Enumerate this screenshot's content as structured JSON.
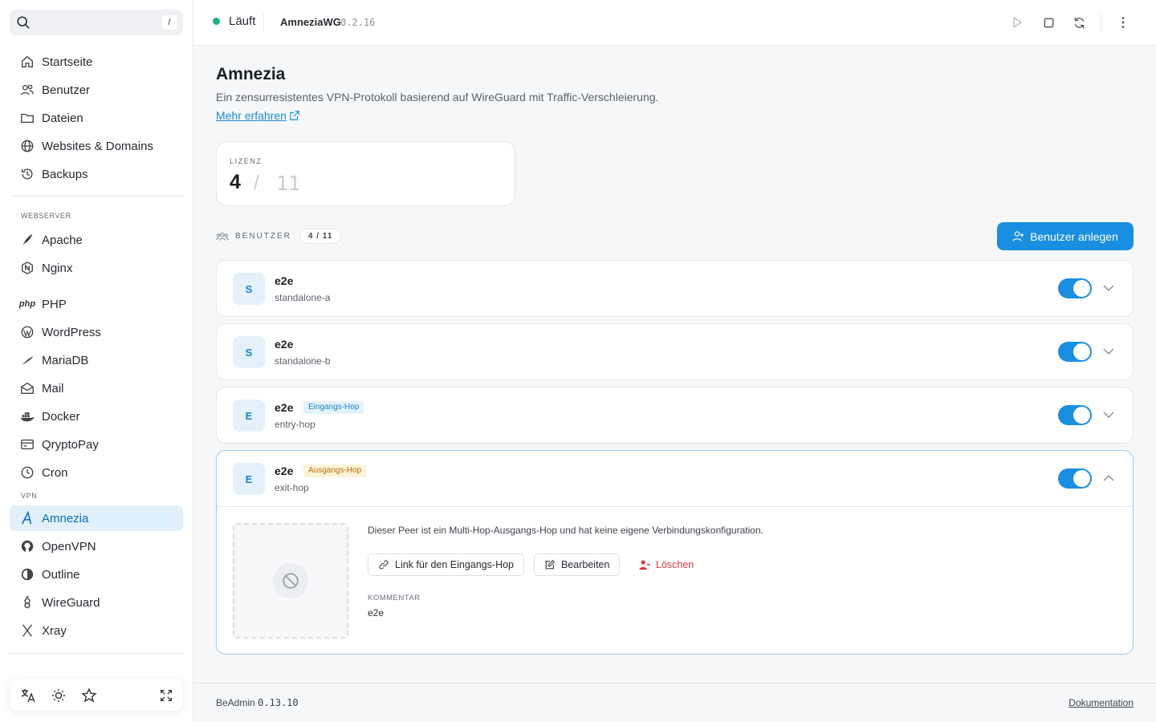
{
  "search": {
    "shortcut": "/"
  },
  "sidebar": {
    "main_items": [
      {
        "label": "Startseite",
        "icon": "home-icon"
      },
      {
        "label": "Benutzer",
        "icon": "users-icon"
      },
      {
        "label": "Dateien",
        "icon": "folder-icon"
      },
      {
        "label": "Websites & Domains",
        "icon": "globe-icon"
      },
      {
        "label": "Backups",
        "icon": "history-icon"
      }
    ],
    "webserver_label": "WEBSERVER",
    "webserver_items": [
      {
        "label": "Apache",
        "icon": "feather-icon"
      },
      {
        "label": "Nginx",
        "icon": "nginx-icon"
      },
      {
        "label": "PHP",
        "icon": "php-icon"
      },
      {
        "label": "WordPress",
        "icon": "wordpress-icon"
      },
      {
        "label": "MariaDB",
        "icon": "seal-icon"
      },
      {
        "label": "Mail",
        "icon": "mail-icon"
      },
      {
        "label": "Docker",
        "icon": "docker-icon"
      },
      {
        "label": "QryptoPay",
        "icon": "card-icon"
      },
      {
        "label": "Cron",
        "icon": "clock-icon"
      }
    ],
    "vpn_label": "VPN",
    "vpn_items": [
      {
        "label": "Amnezia",
        "icon": "amnezia-icon",
        "active": true
      },
      {
        "label": "OpenVPN",
        "icon": "openvpn-icon"
      },
      {
        "label": "Outline",
        "icon": "outline-icon"
      },
      {
        "label": "WireGuard",
        "icon": "wireguard-icon"
      },
      {
        "label": "Xray",
        "icon": "xray-icon"
      }
    ],
    "php_icon_text": "php"
  },
  "topbar": {
    "status": "Läuft",
    "status_color": "#1fb27f",
    "app_name": "AmneziaWG",
    "app_version": "0.2.16"
  },
  "main": {
    "title": "Amnezia",
    "description": "Ein zensurresistentes VPN-Protokoll basierend auf WireGuard mit Traffic-Verschleierung.",
    "more_link": "Mehr erfahren",
    "license": {
      "label": "LIZENZ",
      "current": "4",
      "separator": "/",
      "max": "11"
    },
    "users_label": "BENUTZER",
    "users_count": "4 / 11",
    "add_user_button": "Benutzer anlegen",
    "accent_color": "#1a8ee0",
    "peers": [
      {
        "avatar": "S",
        "name": "e2e",
        "sub": "standalone-a",
        "badge": "",
        "enabled": true
      },
      {
        "avatar": "S",
        "name": "e2e",
        "sub": "standalone-b",
        "badge": "",
        "enabled": true
      },
      {
        "avatar": "E",
        "name": "e2e",
        "sub": "entry-hop",
        "badge": "Eingangs-Hop",
        "enabled": true
      },
      {
        "avatar": "E",
        "name": "e2e",
        "sub": "exit-hop",
        "badge": "Ausgangs-Hop",
        "enabled": true,
        "expanded": true
      }
    ],
    "detail": {
      "text": "Dieser Peer ist ein Multi-Hop-Ausgangs-Hop und hat keine eigene Verbindungskonfiguration.",
      "link_button": "Link für den Eingangs-Hop",
      "edit_button": "Bearbeiten",
      "delete_button": "Löschen",
      "comment_label": "KOMMENTAR",
      "comment_value": "e2e"
    }
  },
  "footer": {
    "product": "BeAdmin",
    "version": "0.13.10",
    "docs_link": "Dokumentation"
  }
}
